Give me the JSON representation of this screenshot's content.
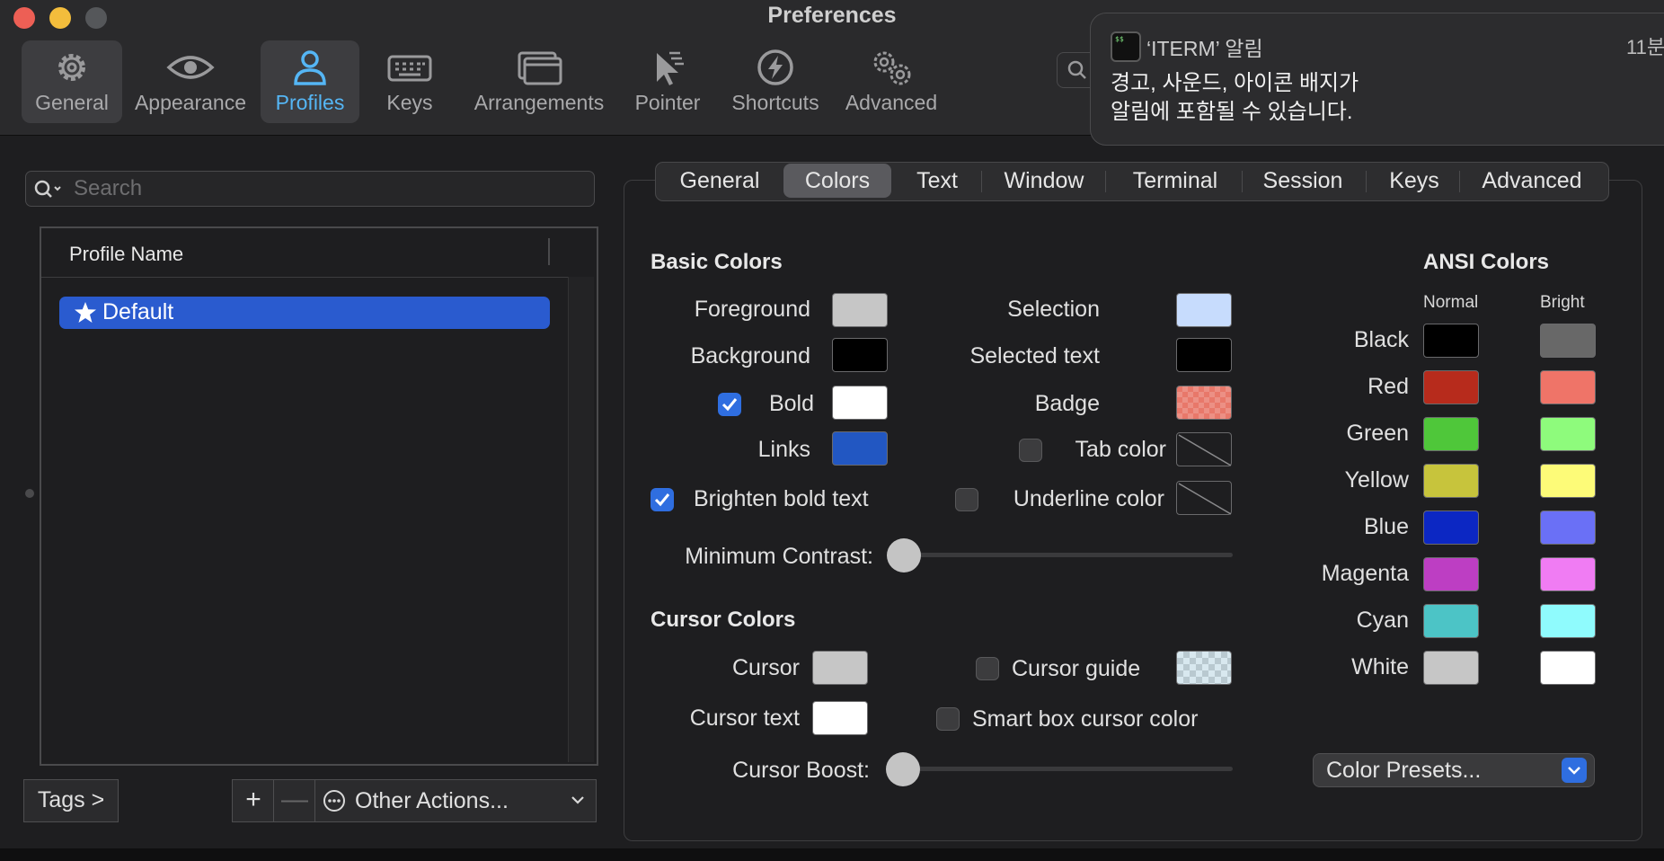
{
  "window": {
    "title": "Preferences"
  },
  "toolbar": {
    "items": [
      {
        "label": "General",
        "icon": "gear-icon"
      },
      {
        "label": "Appearance",
        "icon": "eye-icon"
      },
      {
        "label": "Profiles",
        "icon": "person-icon"
      },
      {
        "label": "Keys",
        "icon": "keyboard-icon"
      },
      {
        "label": "Arrangements",
        "icon": "windows-icon"
      },
      {
        "label": "Pointer",
        "icon": "pointer-icon"
      },
      {
        "label": "Shortcuts",
        "icon": "bolt-icon"
      },
      {
        "label": "Advanced",
        "icon": "gears-icon"
      }
    ]
  },
  "notification": {
    "app": "‘ITERM’ 알림",
    "time": "11분",
    "body_line1": "경고, 사운드, 아이콘 배지가",
    "body_line2": "알림에 포함될 수 있습니다.",
    "icon_text": "$$"
  },
  "sidebar": {
    "search_placeholder": "Search",
    "column_header": "Profile Name",
    "profiles": [
      {
        "name": "Default"
      }
    ],
    "tags_button": "Tags >",
    "add_button": "+",
    "remove_button": "—",
    "other_actions": "Other Actions..."
  },
  "tabs": [
    "General",
    "Colors",
    "Text",
    "Window",
    "Terminal",
    "Session",
    "Keys",
    "Advanced"
  ],
  "basic_colors": {
    "title": "Basic Colors",
    "foreground": {
      "label": "Foreground",
      "color": "#c6c6c6"
    },
    "background": {
      "label": "Background",
      "color": "#000000"
    },
    "bold": {
      "label": "Bold",
      "color": "#ffffff",
      "checked": true
    },
    "links": {
      "label": "Links",
      "color": "#2257c2"
    },
    "selection": {
      "label": "Selection",
      "color": "#c7dcfd"
    },
    "selected_text": {
      "label": "Selected text",
      "color": "#000000"
    },
    "badge": {
      "label": "Badge",
      "color": "#e8786a"
    },
    "tab_color": {
      "label": "Tab color",
      "checked": false
    },
    "underline_color": {
      "label": "Underline color",
      "checked": false
    },
    "brighten_bold": {
      "label": "Brighten bold text",
      "checked": true
    },
    "min_contrast": {
      "label": "Minimum Contrast:",
      "value": 0
    }
  },
  "cursor_colors": {
    "title": "Cursor Colors",
    "cursor": {
      "label": "Cursor",
      "color": "#c6c6c6"
    },
    "cursor_text": {
      "label": "Cursor text",
      "color": "#ffffff"
    },
    "cursor_guide": {
      "label": "Cursor guide",
      "checked": false
    },
    "smart_box": {
      "label": "Smart box cursor color",
      "checked": false
    },
    "cursor_boost": {
      "label": "Cursor Boost:",
      "value": 0
    }
  },
  "ansi": {
    "title": "ANSI Colors",
    "normal_label": "Normal",
    "bright_label": "Bright",
    "rows": [
      {
        "name": "Black",
        "normal": "#000000",
        "bright": "#686868"
      },
      {
        "name": "Red",
        "normal": "#b72b1c",
        "bright": "#ef7468"
      },
      {
        "name": "Green",
        "normal": "#4fc73a",
        "bright": "#8efb7c"
      },
      {
        "name": "Yellow",
        "normal": "#c7c43c",
        "bright": "#fdfb78"
      },
      {
        "name": "Blue",
        "normal": "#0c27c3",
        "bright": "#6a70f6"
      },
      {
        "name": "Magenta",
        "normal": "#bd3ec3",
        "bright": "#f07cf3"
      },
      {
        "name": "Cyan",
        "normal": "#4cc4c6",
        "bright": "#8ffbfd"
      },
      {
        "name": "White",
        "normal": "#c6c6c6",
        "bright": "#ffffff"
      }
    ],
    "presets": "Color Presets..."
  }
}
